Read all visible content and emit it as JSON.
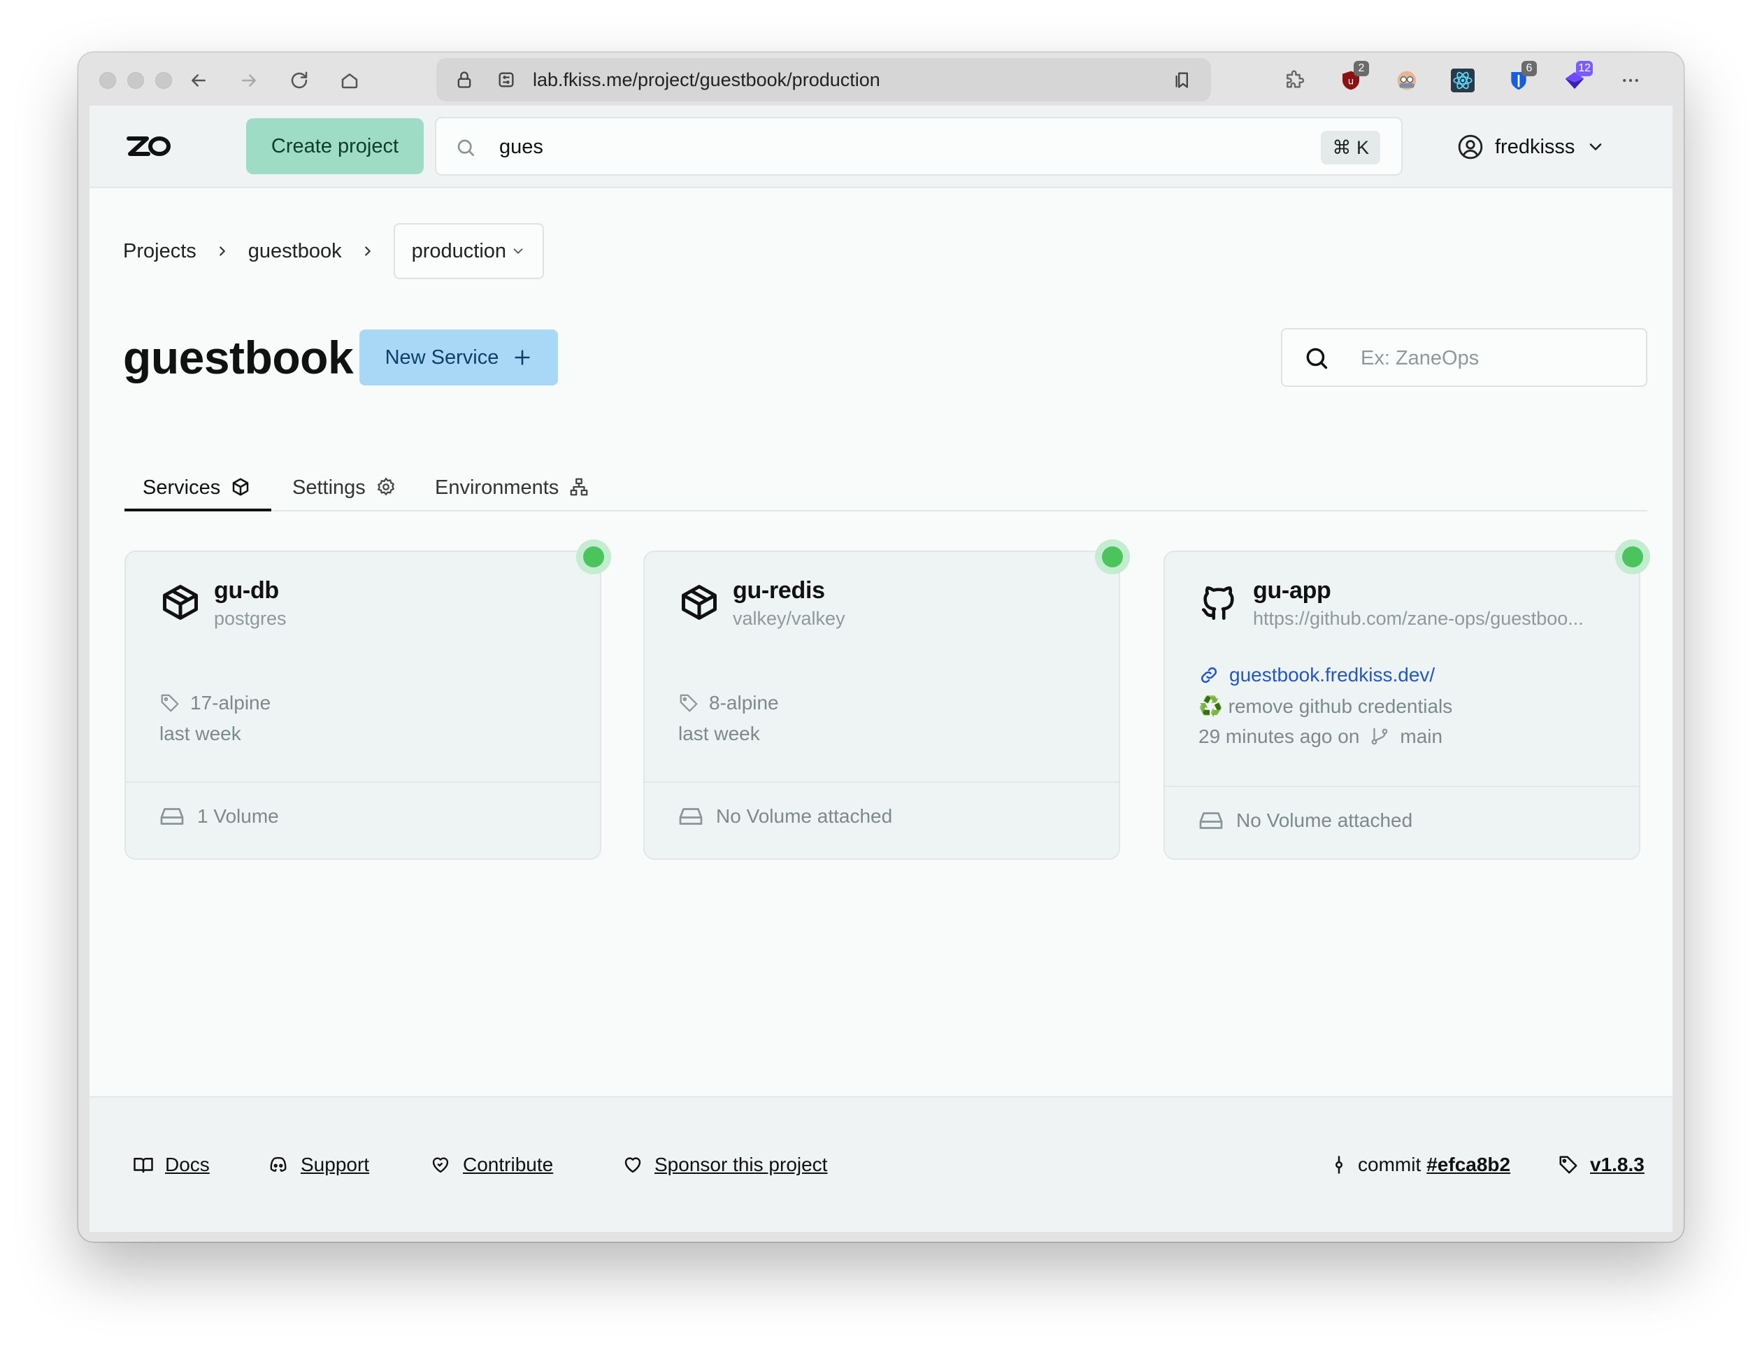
{
  "browser": {
    "url": "lab.fkiss.me/project/guestbook/production",
    "extension_badges": [
      "2",
      "6",
      "12"
    ]
  },
  "header": {
    "logo": "ZO",
    "create_project_label": "Create project",
    "search_value": "gues",
    "search_shortcut": "⌘ K",
    "username": "fredkisss"
  },
  "breadcrumb": {
    "items": [
      "Projects",
      "guestbook"
    ],
    "environment": "production"
  },
  "project": {
    "title": "guestbook",
    "new_service_label": "New Service",
    "search_placeholder": "Ex: ZaneOps"
  },
  "tabs": [
    {
      "label": "Services",
      "icon": "cube-icon",
      "active": true
    },
    {
      "label": "Settings",
      "icon": "gear-icon",
      "active": false
    },
    {
      "label": "Environments",
      "icon": "network-icon",
      "active": false
    }
  ],
  "services": [
    {
      "name": "gu-db",
      "source": "postgres",
      "type": "docker",
      "tag": "17-alpine",
      "updated": "last week",
      "volume": "1 Volume",
      "status_color": "#4cc45d"
    },
    {
      "name": "gu-redis",
      "source": "valkey/valkey",
      "type": "docker",
      "tag": "8-alpine",
      "updated": "last week",
      "volume": "No Volume attached",
      "status_color": "#4cc45d"
    },
    {
      "name": "gu-app",
      "source": "https://github.com/zane-ops/guestboo...",
      "type": "git",
      "url": "guestbook.fredkiss.dev/",
      "commit_message": "♻️ remove github credentials",
      "updated": "29 minutes ago on",
      "branch": "main",
      "volume": "No Volume attached",
      "status_color": "#4cc45d"
    }
  ],
  "footer": {
    "docs": "Docs",
    "support": "Support",
    "contribute": "Contribute",
    "sponsor": "Sponsor this project",
    "commit_label": "commit",
    "commit_hash": "#efca8b2",
    "version": "v1.8.3"
  }
}
